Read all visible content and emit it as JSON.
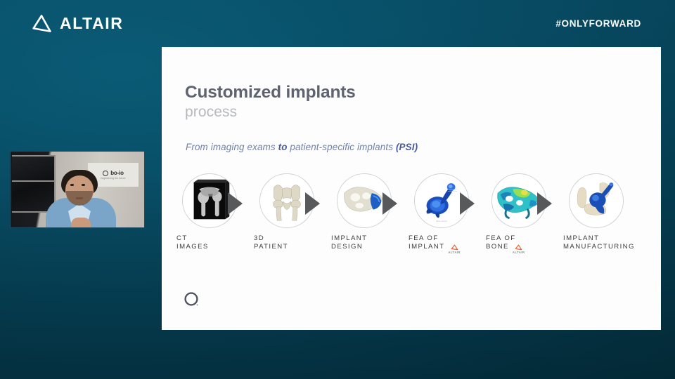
{
  "header": {
    "brand_name": "ALTAIR",
    "brand_icon": "altair-delta-logo",
    "hashtag": "#ONLYFORWARD"
  },
  "slide": {
    "title_main": "Customized implants",
    "title_sub": "process",
    "subtitle": {
      "part1": "From imaging exams ",
      "bold1": "to",
      "part2": " patient-specific implants ",
      "bold2": "(PSI)"
    },
    "bottom_logo": "bone-circle-logo",
    "steps": [
      {
        "line1": "CT",
        "line2": "IMAGES",
        "art": "ct-scan-xray-image",
        "altair_badge": false,
        "arrow": true
      },
      {
        "line1": "3D",
        "line2": "PATIENT",
        "art": "3d-pelvis-bone-model",
        "altair_badge": false,
        "arrow": true
      },
      {
        "line1": "IMPLANT",
        "line2": "DESIGN",
        "art": "pelvis-with-blue-implant",
        "altair_badge": false,
        "arrow": true
      },
      {
        "line1": "FEA OF",
        "line2": "IMPLANT",
        "art": "blue-fea-implant-contour",
        "altair_badge": true,
        "arrow": true
      },
      {
        "line1": "FEA OF",
        "line2": "BONE",
        "art": "teal-fea-bone-contour",
        "altair_badge": true,
        "arrow": true
      },
      {
        "line1": "IMPLANT",
        "line2": "MANUFACTURING",
        "art": "manufactured-implant-bone",
        "altair_badge": false,
        "arrow": false
      }
    ]
  },
  "webcam": {
    "label": "presenter-video-feed",
    "sign_text": "bo-io",
    "sign_tagline": "engineering the future"
  },
  "colors": {
    "background_teal": "#07485f",
    "slide_white": "#fdfdfd",
    "title_gray": "#5d6370",
    "subtitle_blue": "#6e81ab",
    "accent_orange": "#f05a28",
    "arrow_gray": "#58595b"
  }
}
